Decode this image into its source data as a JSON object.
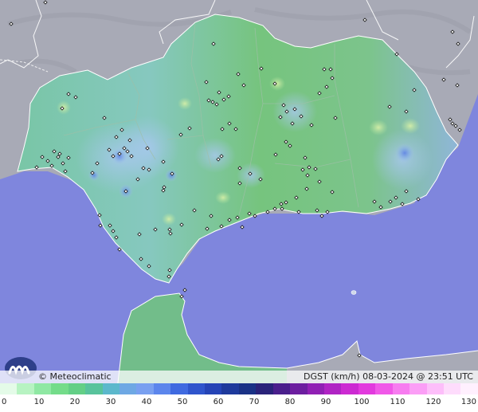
{
  "footer": {
    "credit": "© Meteoclimatic",
    "product": "DGST (km/h)   08-03-2024 @ 23:51 UTC"
  },
  "logo": {
    "icon": "meteoclimatic-logo-icon"
  },
  "legend": {
    "labels": [
      "0",
      "10",
      "20",
      "30",
      "40",
      "50",
      "60",
      "70",
      "80",
      "90",
      "100",
      "110",
      "120",
      "130"
    ],
    "colors": [
      "#e4fbe8",
      "#b7f3c2",
      "#8fe8a3",
      "#74dc8a",
      "#63cf86",
      "#58c39c",
      "#5cb8cc",
      "#6ea8e4",
      "#79a0f0",
      "#5c86ec",
      "#3f6ae0",
      "#2f55cc",
      "#2544b6",
      "#1e3a9c",
      "#1a3286",
      "#2a237a",
      "#4a1f8c",
      "#6d1ea0",
      "#9020b4",
      "#b024c4",
      "#cc2ad2",
      "#e23ade",
      "#f058e8",
      "#f77cf0",
      "#fb9ef6",
      "#fdbefa",
      "#fedcfc",
      "#fff0fe"
    ]
  },
  "colors": {
    "sea": "#7f86dd",
    "land_outside": "#a8aab6",
    "region": "#76c47e"
  }
}
